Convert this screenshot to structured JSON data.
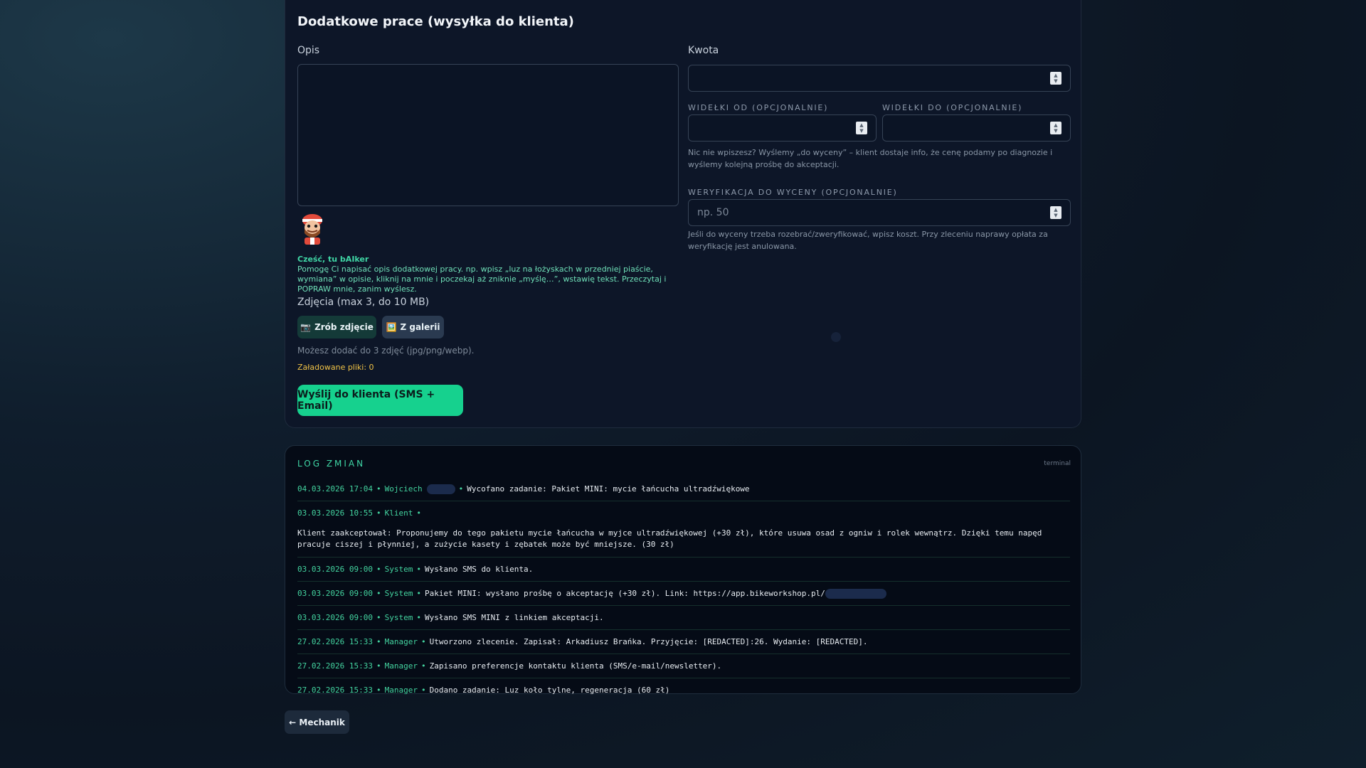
{
  "form": {
    "title": "Dodatkowe prace (wysyłka do klienta)",
    "description_label": "Opis",
    "amount_label": "Kwota",
    "range_from_label": "WIDEŁKI OD (OPCJONALNIE)",
    "range_to_label": "WIDEŁKI DO (OPCJONALNIE)",
    "range_hint": "Nic nie wpiszesz? Wyślemy „do wyceny” – klient dostaje info, że cenę podamy po diagnozie i wyślemy kolejną prośbę do akceptacji.",
    "verification_label": "WERYFIKACJA DO WYCENY (OPCJONALNIE)",
    "verification_placeholder": "np. 50",
    "verification_hint": "Jeśli do wyceny trzeba rozebrać/zweryfikować, wpisz koszt. Przy zleceniu naprawy opłata za weryfikację jest anulowana.",
    "assistant_title": "Cześć, tu bAIker",
    "assistant_text": "Pomogę Ci napisać opis dodatkowej pracy. np. wpisz „luz na łożyskach w przedniej piaście, wymiana” w opisie, kliknij na mnie i poczekaj aż zniknie „myślę…”, wstawię tekst. Przeczytaj i POPRAW mnie, zanim wyślesz.",
    "photos_label": "Zdjęcia (max 3, do 10 MB)",
    "take_photo_label": "Zrób zdjęcie",
    "gallery_label": "Z galerii",
    "photos_note": "Możesz dodać do 3 zdjęć (jpg/png/webp).",
    "loaded_files": "Załadowane pliki: 0",
    "send_label": "Wyślij do klienta (SMS + Email)"
  },
  "icons": {
    "camera": "📷",
    "gallery": "🖼️",
    "back_arrow": "←"
  },
  "log": {
    "title": "LOG ZMIAN",
    "tag": "terminal",
    "entries": [
      {
        "date": "04.03.2026 17:04",
        "author": "Wojciech",
        "text": "Wycofano zadanie: Pakiet MINI: mycie łańcucha ultradźwiękowe"
      },
      {
        "date": "03.03.2026 10:55",
        "author": "Klient",
        "text": "Klient zaakceptował: Proponujemy do tego pakietu mycie łańcucha w myjce ultradźwiękowej (+30 zł), które usuwa osad z ogniw i rolek wewnątrz. Dzięki temu napęd pracuje ciszej i płynniej, a zużycie kasety i zębatek może być mniejsze. (30 zł)"
      },
      {
        "date": "03.03.2026 09:00",
        "author": "System",
        "text": "Wysłano SMS do klienta."
      },
      {
        "date": "03.03.2026 09:00",
        "author": "System",
        "text": "Pakiet MINI: wysłano prośbę o akceptację (+30 zł). Link: https://app.bikeworkshop.pl/"
      },
      {
        "date": "03.03.2026 09:00",
        "author": "System",
        "text": "Wysłano SMS MINI z linkiem akceptacji."
      },
      {
        "date": "27.02.2026 15:33",
        "author": "Manager",
        "text": "Utworzono zlecenie. Zapisał: Arkadiusz Brańka. Przyjęcie: [REDACTED]:26. Wydanie: [REDACTED]."
      },
      {
        "date": "27.02.2026 15:33",
        "author": "Manager",
        "text": "Zapisano preferencje kontaktu klienta (SMS/e-mail/newsletter)."
      },
      {
        "date": "27.02.2026 15:33",
        "author": "Manager",
        "text": "Dodano zadanie: Luz koło tylne, regeneracja (60 zł)"
      }
    ]
  },
  "back_button": "Mechanik",
  "separator": "•"
}
